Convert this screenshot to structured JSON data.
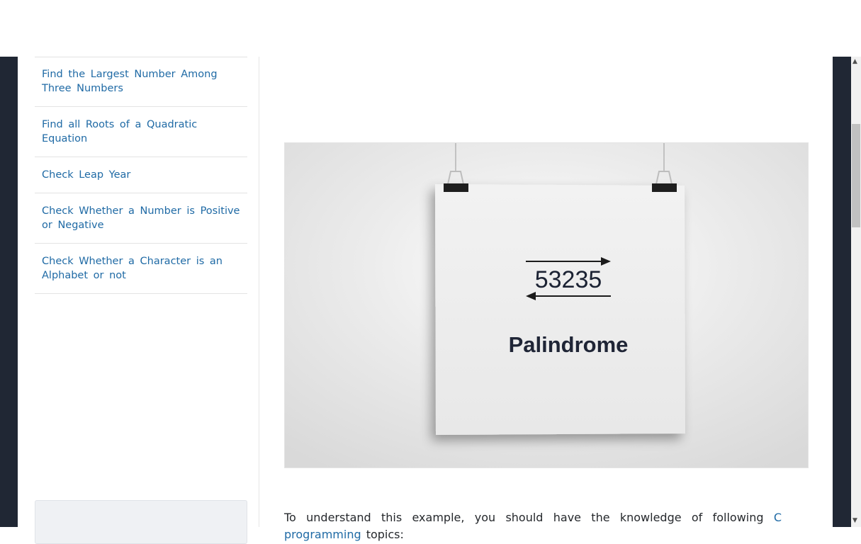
{
  "sidebar": {
    "items": [
      {
        "label": "Find the Largest Number Among Three Numbers"
      },
      {
        "label": "Find all Roots of a Quadratic Equation"
      },
      {
        "label": "Check Leap Year"
      },
      {
        "label": "Check Whether a Number is Positive or Negative"
      },
      {
        "label": "Check Whether a Character is an Alphabet or not"
      }
    ]
  },
  "hero": {
    "number": "53235",
    "caption": "Palindrome"
  },
  "intro": {
    "before_link": "To understand this example, you should have the knowledge of following ",
    "link_text": "C programming",
    "after_link": " topics:"
  },
  "colors": {
    "link": "#1f6aa5",
    "gutter": "#202734",
    "text": "#25282c"
  }
}
